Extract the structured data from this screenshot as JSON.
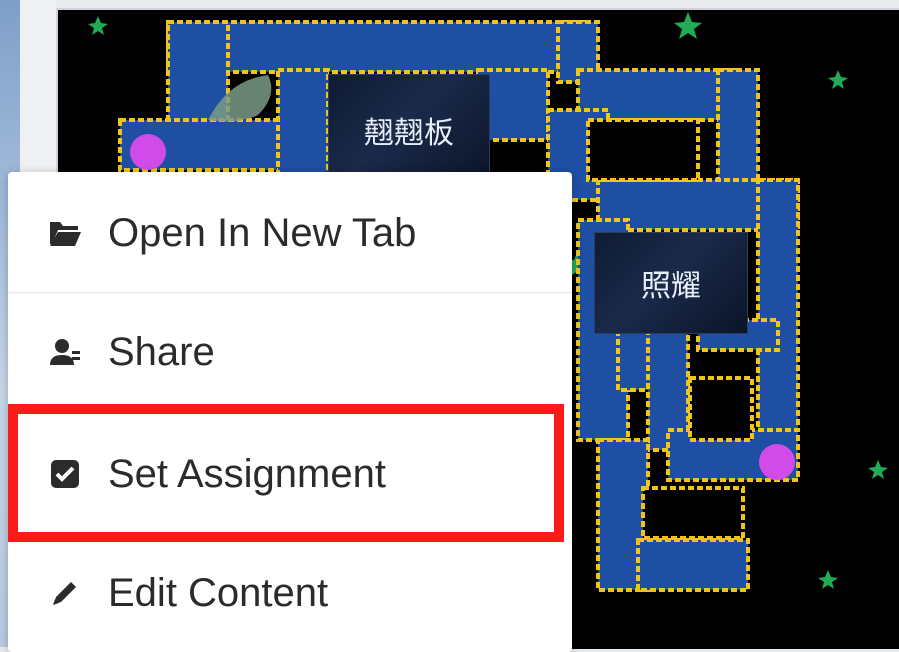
{
  "menu": {
    "items": [
      {
        "label": "Open In New Tab",
        "icon": "folder-open-icon"
      },
      {
        "label": "Share",
        "icon": "user-share-icon"
      },
      {
        "label": "Set Assignment",
        "icon": "check-square-icon"
      },
      {
        "label": "Edit Content",
        "icon": "pencil-icon"
      }
    ],
    "highlighted_item": "Set Assignment",
    "highlight_color": "#ff1a1a"
  },
  "game": {
    "words": [
      "翹翹板",
      "照耀"
    ],
    "colors": {
      "maze_path": "#1f4fa3",
      "maze_wall": "#f0c419",
      "enemy": "#d04be8",
      "star": "#2bd46a"
    }
  }
}
